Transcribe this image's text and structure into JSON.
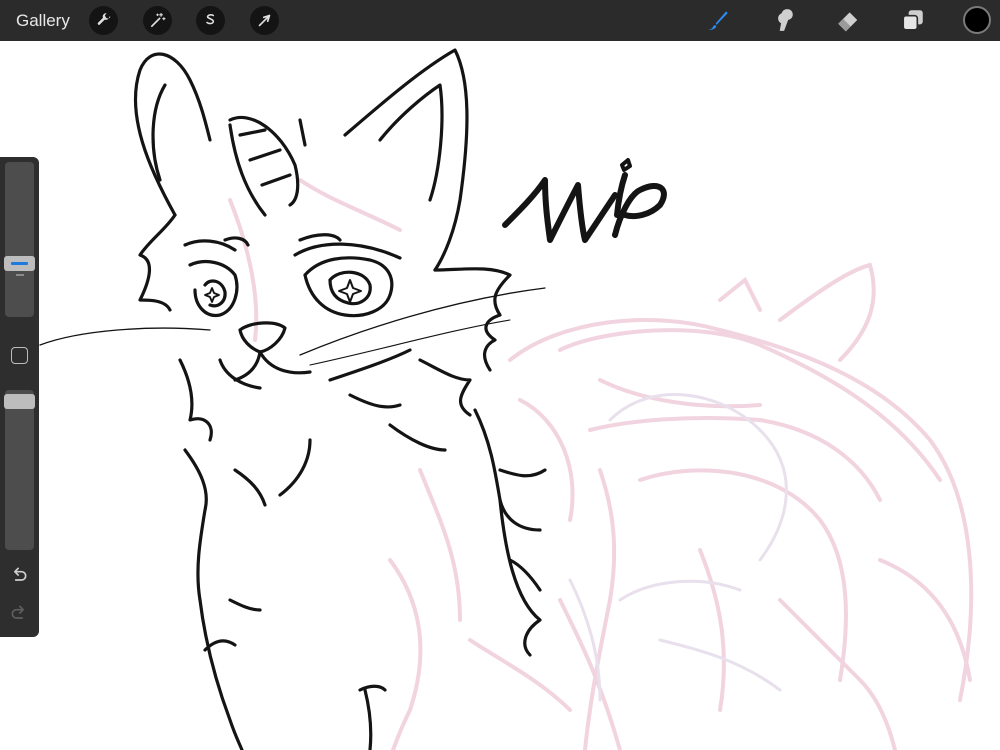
{
  "toolbar": {
    "gallery_label": "Gallery",
    "left_tools": [
      {
        "name": "actions",
        "icon": "wrench-icon"
      },
      {
        "name": "adjustments",
        "icon": "magic-wand-icon"
      },
      {
        "name": "selection",
        "icon": "selection-s-icon"
      },
      {
        "name": "transform",
        "icon": "arrow-cursor-icon"
      }
    ],
    "right_tools": [
      {
        "name": "brush",
        "icon": "brush-icon",
        "active": true
      },
      {
        "name": "smudge",
        "icon": "smudge-icon",
        "active": false
      },
      {
        "name": "eraser",
        "icon": "eraser-icon",
        "active": false
      },
      {
        "name": "layers",
        "icon": "layers-icon",
        "active": false
      }
    ],
    "current_color": "#000000"
  },
  "sidebar": {
    "brush_size_icon": "slider-thumb",
    "modify_icon": "square-modify-icon",
    "undo_icon": "undo-icon",
    "redo_icon": "redo-icon"
  },
  "canvas": {
    "lettering": "Wip",
    "ink_color": "#141414",
    "sketch_color": "#f1d4df"
  },
  "colors": {
    "toolbar_bg": "#2b2b2b",
    "sidebar_bg": "#2e2e2e",
    "accent": "#1f7ae0"
  }
}
